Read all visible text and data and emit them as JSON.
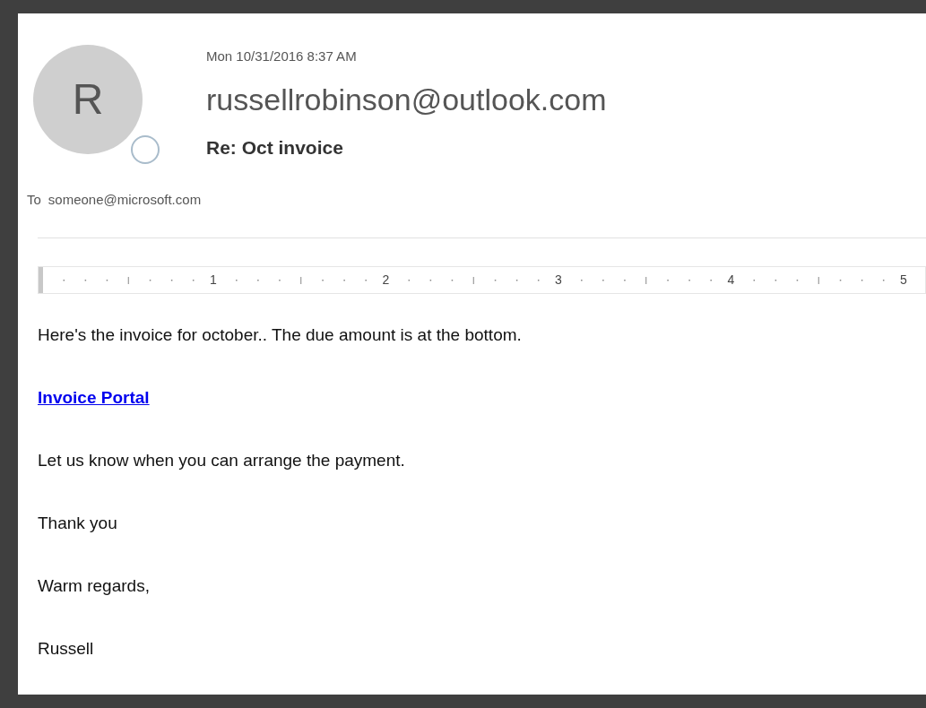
{
  "header": {
    "avatar_initial": "R",
    "date": "Mon 10/31/2016 8:37 AM",
    "sender": "russellrobinson@outlook.com",
    "subject": "Re: Oct invoice",
    "to_label": "To",
    "to_address": "someone@microsoft.com"
  },
  "ruler": {
    "labels": [
      "1",
      "2",
      "3",
      "4",
      "5"
    ]
  },
  "body": [
    {
      "kind": "text",
      "text": "Here's the invoice for october.. The due amount is at the bottom."
    },
    {
      "kind": "link",
      "text": "Invoice Portal"
    },
    {
      "kind": "text",
      "text": "Let us know when you can arrange the payment."
    },
    {
      "kind": "text",
      "text": "Thank you"
    },
    {
      "kind": "text",
      "text": "Warm regards,"
    },
    {
      "kind": "text",
      "text": "Russell"
    }
  ]
}
